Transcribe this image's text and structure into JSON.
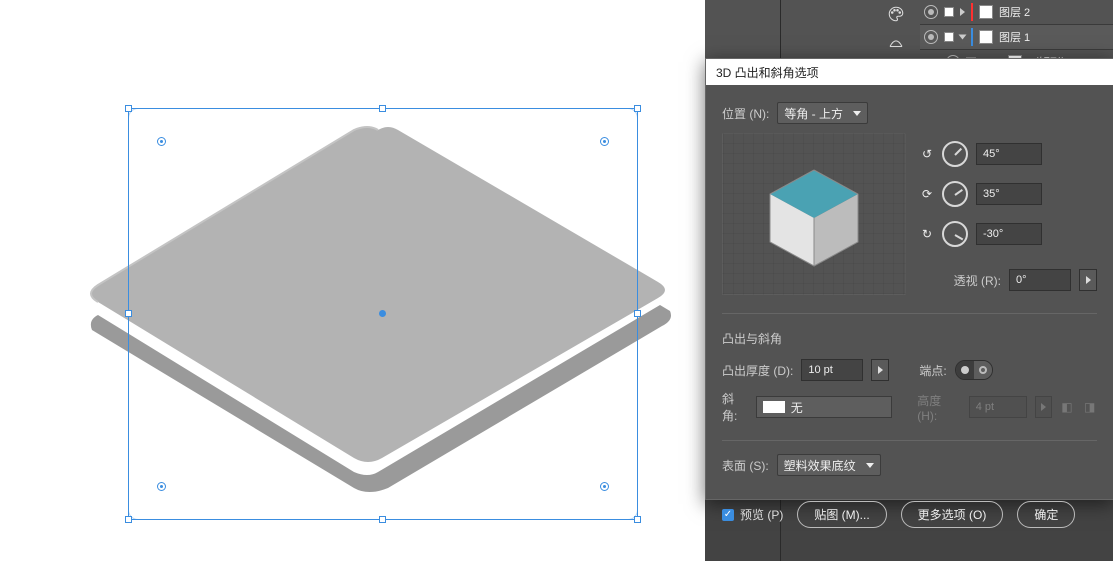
{
  "layers": {
    "row1_label": "图层 2",
    "row2_label": "图层 1",
    "row3_label": "〈矩形〉"
  },
  "dialog": {
    "title": "3D 凸出和斜角选项",
    "position_label": "位置 (N):",
    "position_value": "等角 - 上方",
    "rot1_value": "45°",
    "rot2_value": "35°",
    "rot3_value": "-30°",
    "perspective_label": "透视 (R):",
    "perspective_value": "0°",
    "extrude_section": "凸出与斜角",
    "extrude_depth_label": "凸出厚度 (D):",
    "extrude_depth_value": "10 pt",
    "cap_label": "端点:",
    "bevel_label": "斜角:",
    "bevel_value": "无",
    "height_label": "高度 (H):",
    "height_value": "4 pt",
    "surface_label": "表面 (S):",
    "surface_value": "塑料效果底纹",
    "preview_label": "预览 (P)",
    "map_art_btn": "贴图 (M)...",
    "more_options_btn": "更多选项 (O)",
    "ok_btn": "确定"
  }
}
